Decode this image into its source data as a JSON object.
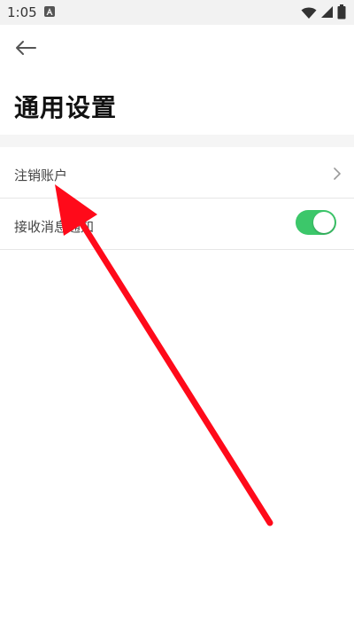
{
  "status_bar": {
    "time": "1:05",
    "icons": [
      "notification-a-icon",
      "wifi-icon",
      "cellular-signal-icon",
      "battery-icon"
    ]
  },
  "header": {
    "back_icon": "arrow-left-icon",
    "title": "通用设置"
  },
  "settings": {
    "items": [
      {
        "label": "注销账户",
        "control": "chevron-right-icon"
      },
      {
        "label": "接收消息通知",
        "control": "toggle",
        "enabled": true
      }
    ]
  },
  "colors": {
    "toggle_on": "#3cc76a",
    "annotation_arrow": "#ff0a1a",
    "section_gap": "#f5f5f5"
  }
}
